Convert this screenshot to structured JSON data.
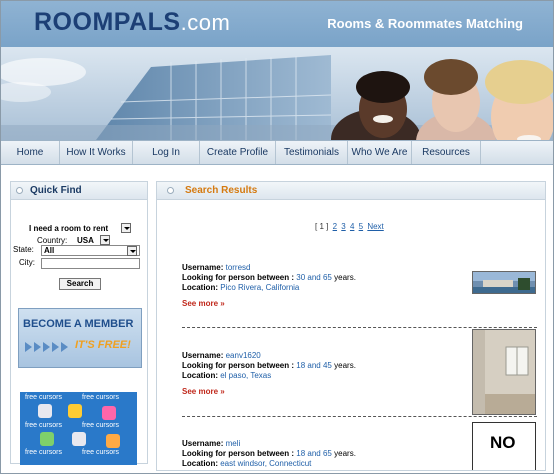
{
  "header": {
    "logo_main": "ROOMPALS",
    "logo_domain": ".com",
    "tagline": "Rooms & Roommates Matching"
  },
  "nav": {
    "items": [
      "Home",
      "How It Works",
      "Log In",
      "Create Profile",
      "Testimonials",
      "Who We Are",
      "Resources"
    ]
  },
  "quick_find": {
    "title": "Quick Find",
    "need_label": "I need a room to rent",
    "country_label": "Country:",
    "country_value": "USA",
    "state_label": "State:",
    "state_value": "All",
    "city_label": "City:",
    "city_value": "",
    "search_label": "Search"
  },
  "member_banner": {
    "line1": "BECOME A MEMBER",
    "line2": "IT'S FREE!"
  },
  "cursors_ad": {
    "text": "free cursors"
  },
  "results": {
    "title": "Search Results",
    "pager": {
      "current": "[ 1 ]",
      "pages": [
        "2",
        "3",
        "4",
        "5"
      ],
      "next": "Next"
    },
    "labels": {
      "username": "Username:",
      "looking": "Looking for person between :",
      "and": "and",
      "years": "years.",
      "location": "Location:",
      "see_more": "See more",
      "see_more_arrow": "»"
    },
    "items": [
      {
        "username": "torresd",
        "age_min": "30",
        "age_max": "65",
        "location": "Pico Rivera, California"
      },
      {
        "username": "eanv1620",
        "age_min": "18",
        "age_max": "45",
        "location": "el paso, Texas"
      },
      {
        "username": "meli",
        "age_min": "18",
        "age_max": "65",
        "location": "east windsor, Connecticut"
      }
    ],
    "no_photo_text": "NO"
  },
  "colors": {
    "header_blue": "#7aa3c8",
    "logo_navy": "#1c3f75",
    "nav_text": "#1b3a63",
    "results_title": "#d57a10",
    "link_blue": "#1f5fa8",
    "see_more_red": "#c0281b"
  }
}
